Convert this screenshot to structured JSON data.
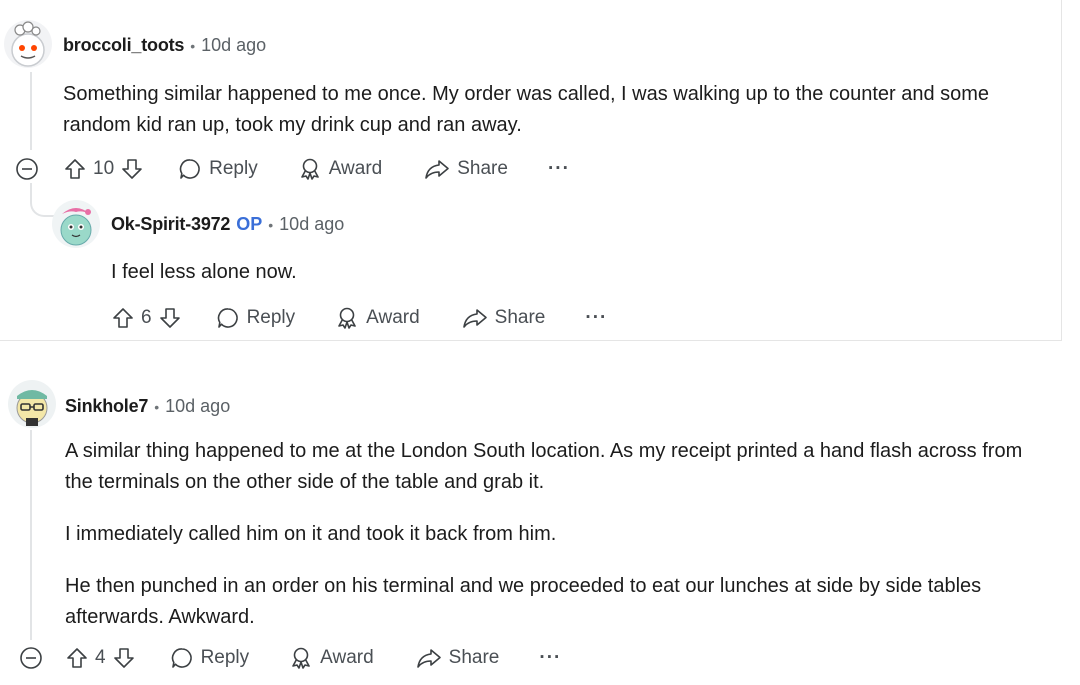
{
  "comments": [
    {
      "username": "broccoli_toots",
      "separator": "•",
      "time": "10d ago",
      "body": [
        "Something similar happened to me once. My order was called, I was walking up to the counter and some",
        "random kid ran up, took my drink cup and ran away."
      ],
      "votes": "10",
      "actions": {
        "reply": "Reply",
        "award": "Award",
        "share": "Share",
        "more": "···"
      }
    },
    {
      "username": "Ok-Spirit-3972",
      "op_badge": "OP",
      "separator": "•",
      "time": "10d ago",
      "body": [
        "I feel less alone now."
      ],
      "votes": "6",
      "actions": {
        "reply": "Reply",
        "award": "Award",
        "share": "Share",
        "more": "···"
      }
    },
    {
      "username": "Sinkhole7",
      "separator": "•",
      "time": "10d ago",
      "body": [
        "A similar thing happened to me at the London South location. As my receipt printed a hand flash across from",
        "the terminals on the other side of the table and grab it.",
        "I immediately called him on it and took it back from him.",
        "He then punched in an order on his terminal and we proceeded to eat our lunches at side by side tables",
        "afterwards. Awkward."
      ],
      "votes": "4",
      "actions": {
        "reply": "Reply",
        "award": "Award",
        "share": "Share",
        "more": "···"
      }
    }
  ]
}
